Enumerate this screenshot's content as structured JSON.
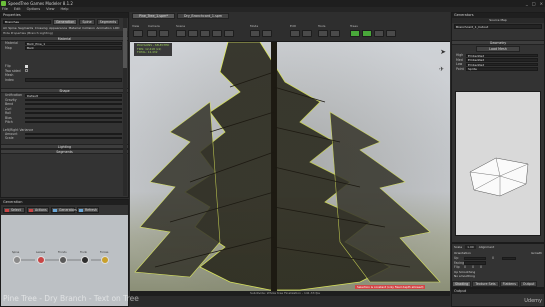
{
  "app": {
    "title": "SpeedTree Games Modeler 8.1.2",
    "window_controls": [
      "_",
      "□",
      "×"
    ],
    "menu": [
      "File",
      "Edit",
      "Options",
      "View",
      "Help"
    ]
  },
  "properties_panel": {
    "title": "Properties",
    "selected_object": "Branches",
    "tabs": [
      "Generation",
      "Spine",
      "Segments"
    ],
    "subtabs": [
      "All",
      "Spine",
      "Segments",
      "Crossing",
      "Appearance",
      "Material",
      "Collision",
      "Animation",
      "LOD"
    ],
    "object_header": "Hide Properties (Branch Lighting)",
    "sections": {
      "material": {
        "label": "Material",
        "rows": [
          {
            "label": "Material",
            "value": "Bark_Pine_1"
          },
          {
            "label": "Map",
            "value": "Bark"
          }
        ]
      },
      "fixed": [
        {
          "label": "Flip",
          "checked": true
        },
        {
          "label": "Two sided",
          "checked": false
        },
        {
          "label": "Mesh",
          "value": ""
        },
        {
          "label": "Index",
          "value": ""
        }
      ],
      "shape": {
        "label": "Shape",
        "rows": [
          {
            "label": "Unification",
            "value": "Default"
          },
          {
            "label": "Gravity",
            "fill": 0.3
          },
          {
            "label": "Bend",
            "fill": 0.45
          },
          {
            "label": "Curl",
            "fill": 0.35
          },
          {
            "label": "Roll",
            "fill": 0.25
          },
          {
            "label": "Bias",
            "fill": 0.5
          },
          {
            "label": "Pitch",
            "fill": 0.4
          }
        ]
      },
      "left_right": {
        "label": "Left/Right Variance",
        "rows": [
          {
            "label": "Amount",
            "fill": 0.3
          },
          {
            "label": "Scale",
            "fill": 0.4
          }
        ]
      },
      "lighting_label": "Lighting",
      "segments_label": "Segments"
    }
  },
  "generation_panel": {
    "title": "Generation",
    "buttons": [
      "Select",
      "Actions",
      "Generators",
      "Refresh"
    ],
    "nodes": [
      {
        "label": "Spine",
        "color": "#8a8a8a"
      },
      {
        "label": "Leaves",
        "color": "#c94545"
      },
      {
        "label": "Fronds",
        "color": "#5a5a5a"
      },
      {
        "label": "Trunk",
        "color": "#2e2e2e"
      },
      {
        "label": "Forces",
        "color": "#c9a02a"
      }
    ]
  },
  "watermark": "Pine Tree - Dry Branch - Text on Tree",
  "viewport": {
    "tabs": [
      "Pine_Tree_1.spm*",
      "Dry_Branchcard_1.spm"
    ],
    "toolbar_groups": [
      "View",
      "Camera",
      "Scene",
      "Mode",
      "Edit",
      "Tools",
      "Trees"
    ],
    "stats": [
      "POLYGONS - SELECTED",
      "TRIS: 12,418 (x1)",
      "TOTAL: 12,432"
    ],
    "status_text": "Selection is constant (only fixed depth allowed)",
    "status_right": "Subdivide: Whole tree   Finalization - 141.33 fps"
  },
  "right_panel": {
    "title": "Generators",
    "subtitle": "Source Map",
    "map_name": "Branchcard_1_Cutout",
    "geometry_label": "Geometry",
    "load_button": "Load Mesh",
    "lod_rows": [
      {
        "label": "High",
        "value": "Embedded"
      },
      {
        "label": "Med",
        "value": "Embedded"
      },
      {
        "label": "Low",
        "value": "Embedded"
      },
      {
        "label": "Point",
        "value": "Sprite"
      }
    ],
    "bottom_controls": {
      "scale_label": "Scale",
      "scale_value": "1.00",
      "alignment_label": "Alignment",
      "orientation_label": "Orientation",
      "up_label": "Up",
      "facing_label": "Facing",
      "growth_label": "Growth",
      "scale_v": "0",
      "flip_label": "Flip",
      "flip_values": [
        "0",
        "0",
        "0"
      ],
      "smoothing_label": "Up Smoothing",
      "no_smooth": "No smoothing",
      "tabs": [
        "Shading",
        "Texture Sets",
        "Flattens",
        "Output"
      ]
    }
  },
  "output_panel": {
    "title": "Output",
    "text": "Udemy"
  },
  "colors": {
    "accent": "#49a83a",
    "selection": "#e4f05a",
    "sky": "#cfd2d6",
    "ground": "#8b8f77"
  }
}
